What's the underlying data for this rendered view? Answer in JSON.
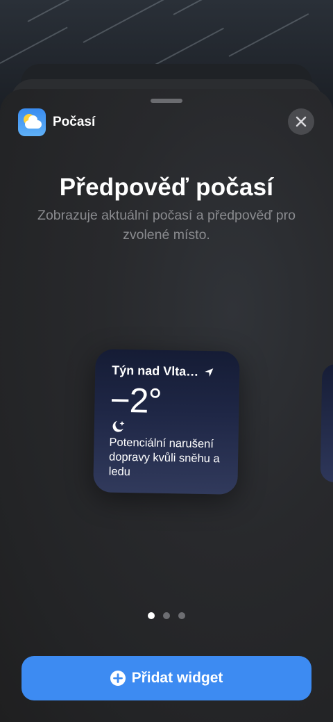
{
  "app": {
    "name": "Počasí",
    "icon": "weather-app-icon"
  },
  "header": {
    "close_icon": "close-icon"
  },
  "widget_info": {
    "title": "Předpověď počasí",
    "description": "Zobrazuje aktuální počasí a předpověď pro zvolené místo."
  },
  "widget_preview": {
    "location": "Týn nad Vlta…",
    "location_icon": "location-arrow-icon",
    "temperature": "−2°",
    "condition_icon": "moon-stars-icon",
    "condition": "Potenciální narušení dopravy kvůli sněhu a ledu"
  },
  "pagination": {
    "count": 3,
    "active_index": 0
  },
  "actions": {
    "add_label": "Přidat widget",
    "add_icon": "plus-circle-icon"
  },
  "colors": {
    "accent": "#3d8bf2",
    "sheet": "#28292c",
    "widget_top": "#151c35",
    "widget_bottom": "#313a5c"
  }
}
